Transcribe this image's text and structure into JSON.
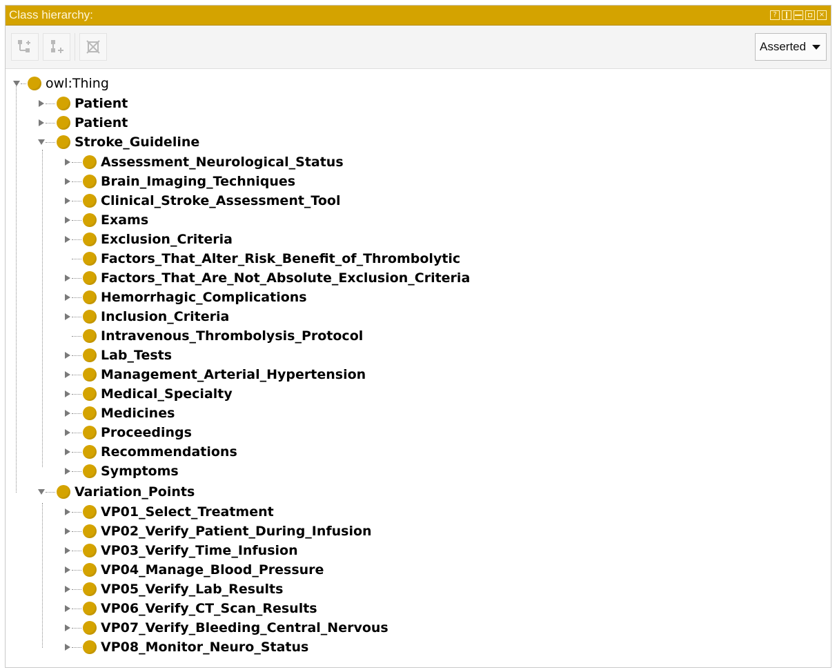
{
  "panel": {
    "title": "Class hierarchy:",
    "window_buttons": [
      {
        "icon": "help-icon",
        "glyph": "?"
      },
      {
        "icon": "split-vertical-icon",
        "glyph": ""
      },
      {
        "icon": "split-horizontal-icon",
        "glyph": ""
      },
      {
        "icon": "maximize-icon",
        "glyph": ""
      },
      {
        "icon": "close-icon",
        "glyph": "×"
      }
    ]
  },
  "toolbar": {
    "buttons": [
      {
        "icon": "add-subclass-icon"
      },
      {
        "icon": "add-sibling-class-icon"
      },
      {
        "icon": "delete-class-icon"
      }
    ],
    "view_mode": "Asserted"
  },
  "colors": {
    "accent": "#d4a300",
    "title_text": "#fff6d8"
  },
  "tree": {
    "root": "owl:Thing",
    "level1": [
      "Patient",
      "Patient",
      "Stroke_Guideline",
      "Variation_Points"
    ],
    "stroke_children": [
      "Assessment_Neurological_Status",
      "Brain_Imaging_Techniques",
      "Clinical_Stroke_Assessment_Tool",
      "Exams",
      "Exclusion_Criteria",
      "Factors_That_Alter_Risk_Benefit_of_Thrombolytic",
      "Factors_That_Are_Not_Absolute_Exclusion_Criteria",
      "Hemorrhagic_Complications",
      "Inclusion_Criteria",
      "Intravenous_Thrombolysis_Protocol",
      "Lab_Tests",
      "Management_Arterial_Hypertension",
      "Medical_Specialty",
      "Medicines",
      "Proceedings",
      "Recommendations",
      "Symptoms"
    ],
    "variation_children": [
      "VP01_Select_Treatment",
      "VP02_Verify_Patient_During_Infusion",
      "VP03_Verify_Time_Infusion",
      "VP04_Manage_Blood_Pressure",
      "VP05_Verify_Lab_Results",
      "VP06_Verify_CT_Scan_Results",
      "VP07_Verify_Bleeding_Central_Nervous",
      "VP08_Monitor_Neuro_Status"
    ]
  }
}
